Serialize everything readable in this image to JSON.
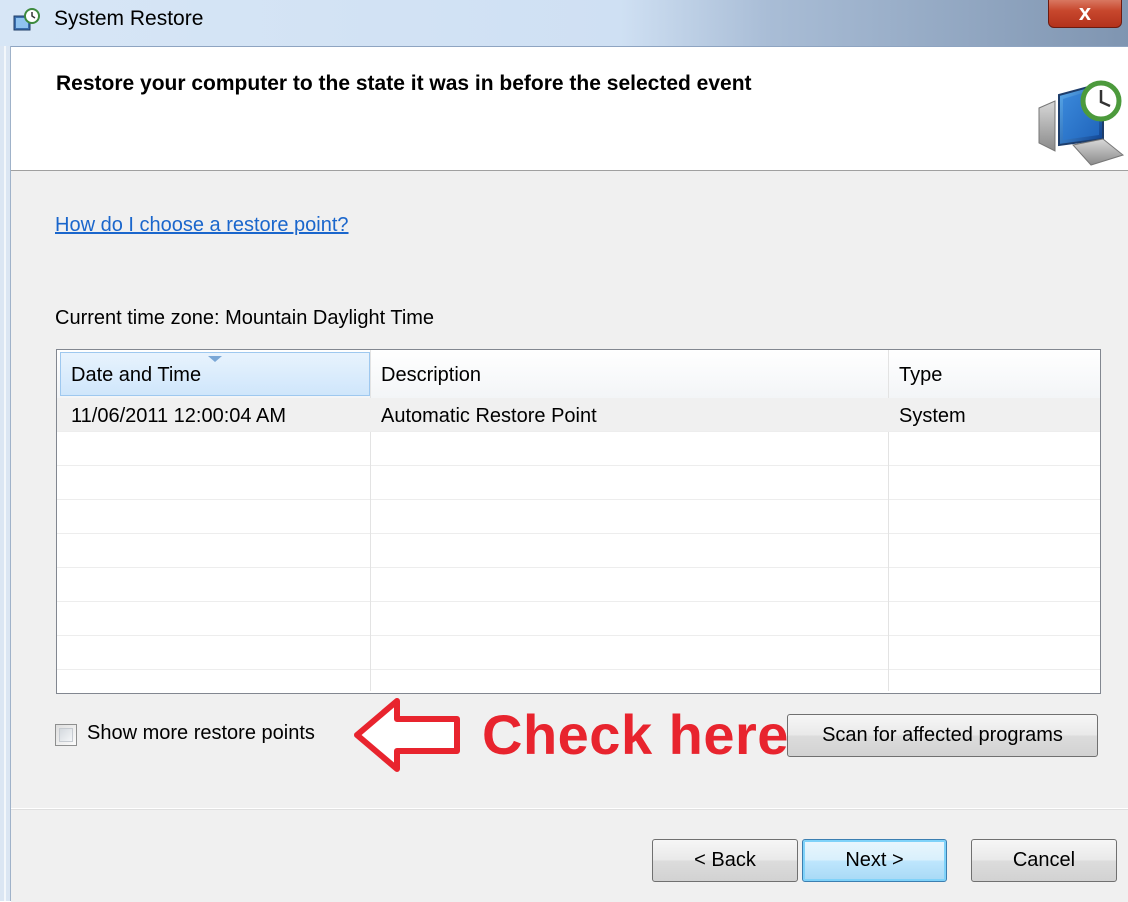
{
  "window": {
    "title": "System Restore",
    "close_label": "x"
  },
  "header": {
    "heading": "Restore your computer to the state it was in before the selected event"
  },
  "help_link": "How do I choose a restore point?",
  "timezone_label": "Current time zone: Mountain Daylight Time",
  "table": {
    "columns": [
      "Date and Time",
      "Description",
      "Type"
    ],
    "rows": [
      {
        "date": "11/06/2011 12:00:04 AM",
        "description": "Automatic Restore Point",
        "type": "System"
      }
    ]
  },
  "checkbox": {
    "label": "Show more restore points",
    "checked": false
  },
  "buttons": {
    "scan": "Scan for affected programs",
    "back": "< Back",
    "next": "Next >",
    "cancel": "Cancel"
  },
  "annotation": {
    "text": "Check here",
    "color": "#e8242e"
  },
  "colors": {
    "link": "#1a66cc",
    "selection_header": "#cfe6fb"
  }
}
